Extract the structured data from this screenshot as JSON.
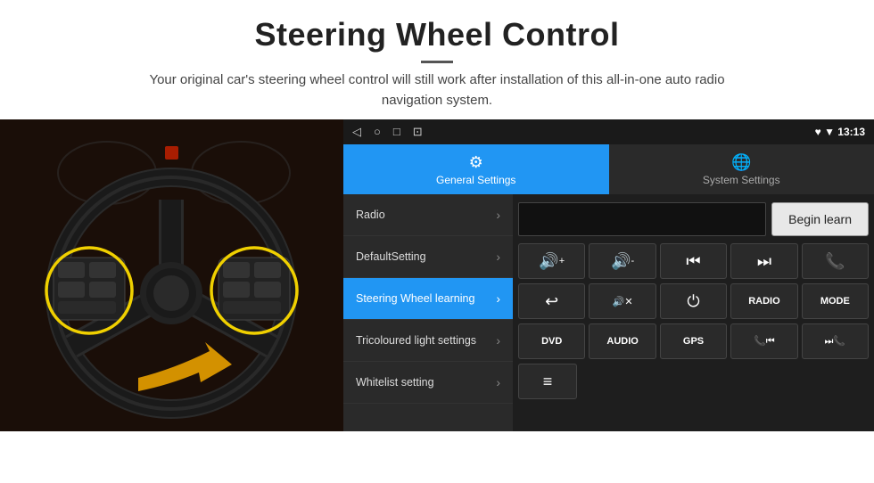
{
  "header": {
    "title": "Steering Wheel Control",
    "divider": true,
    "subtitle": "Your original car's steering wheel control will still work after installation of this all-in-one auto radio navigation system."
  },
  "status_bar": {
    "nav_icons": [
      "◁",
      "○",
      "□",
      "⊡"
    ],
    "right": "♥ ▼  13:13"
  },
  "tabs": [
    {
      "id": "general",
      "label": "General Settings",
      "icon": "⚙",
      "active": true
    },
    {
      "id": "system",
      "label": "System Settings",
      "icon": "🌐",
      "active": false
    }
  ],
  "menu": {
    "items": [
      {
        "label": "Radio",
        "active": false
      },
      {
        "label": "DefaultSetting",
        "active": false
      },
      {
        "label": "Steering Wheel learning",
        "active": true
      },
      {
        "label": "Tricoloured light settings",
        "active": false
      },
      {
        "label": "Whitelist setting",
        "active": false
      }
    ]
  },
  "controls": {
    "begin_learn_label": "Begin learn",
    "rows": [
      [
        "🔊+",
        "🔊-",
        "⏮",
        "⏭",
        "📞"
      ],
      [
        "↩",
        "🔊x",
        "⏻",
        "RADIO",
        "MODE"
      ],
      [
        "DVD",
        "AUDIO",
        "GPS",
        "📞⏮",
        "⏭📞"
      ]
    ],
    "last_row_icon": "≡"
  }
}
